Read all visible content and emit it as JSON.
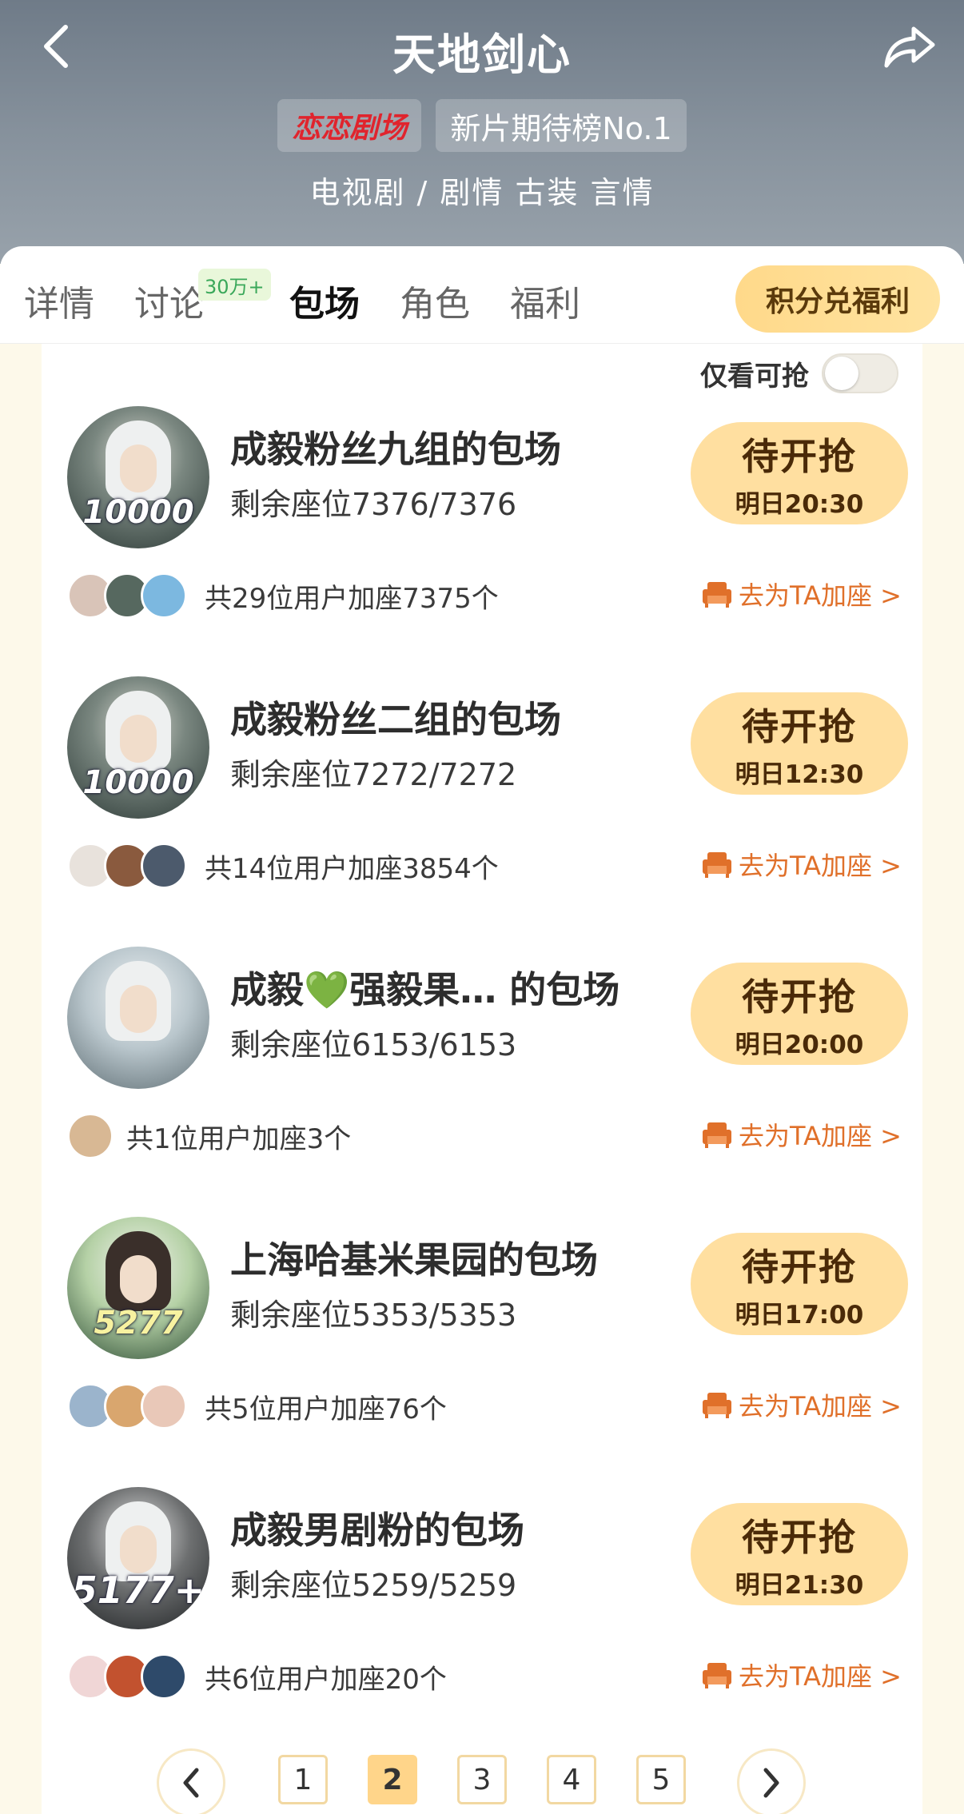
{
  "header": {
    "title": "天地剑心",
    "brand_badge": "恋恋剧场",
    "rank_badge": "新片期待榜No.1",
    "genres": "电视剧 / 剧情 古装 言情"
  },
  "tabs": [
    {
      "label": "详情",
      "active": false
    },
    {
      "label": "讨论",
      "active": false,
      "badge": "30万+"
    },
    {
      "label": "包场",
      "active": true
    },
    {
      "label": "角色",
      "active": false
    },
    {
      "label": "福利",
      "active": false
    }
  ],
  "points_button": "积分兑福利",
  "filter": {
    "label": "仅看可抢",
    "toggle_on": false
  },
  "cards": [
    {
      "title": "成毅粉丝九组的包场",
      "seats": "剩余座位7376/7376",
      "avatar_text": "10000",
      "button": "待开抢",
      "time": "明日20:30",
      "users_text": "共29位用户加座7375个",
      "add_link": "去为TA加座 >"
    },
    {
      "title": "成毅粉丝二组的包场",
      "seats": "剩余座位7272/7272",
      "avatar_text": "10000",
      "button": "待开抢",
      "time": "明日12:30",
      "users_text": "共14位用户加座3854个",
      "add_link": "去为TA加座 >"
    },
    {
      "title": "成毅💚强毅果…  的包场",
      "seats": "剩余座位6153/6153",
      "avatar_text": "",
      "button": "待开抢",
      "time": "明日20:00",
      "users_text": "共1位用户加座3个",
      "add_link": "去为TA加座 >"
    },
    {
      "title": "上海哈基米果园的包场",
      "seats": "剩余座位5353/5353",
      "avatar_text": "5277",
      "button": "待开抢",
      "time": "明日17:00",
      "users_text": "共5位用户加座76个",
      "add_link": "去为TA加座 >"
    },
    {
      "title": "成毅男剧粉的包场",
      "seats": "剩余座位5259/5259",
      "avatar_text": "5177+",
      "button": "待开抢",
      "time": "明日21:30",
      "users_text": "共6位用户加座20个",
      "add_link": "去为TA加座 >"
    }
  ],
  "pagination": {
    "pages": [
      "1",
      "2",
      "3",
      "4",
      "5"
    ],
    "current": "2"
  },
  "colors": {
    "accent": "#ffdfa0",
    "link": "#e0702a",
    "brand_red": "#e0242d"
  }
}
